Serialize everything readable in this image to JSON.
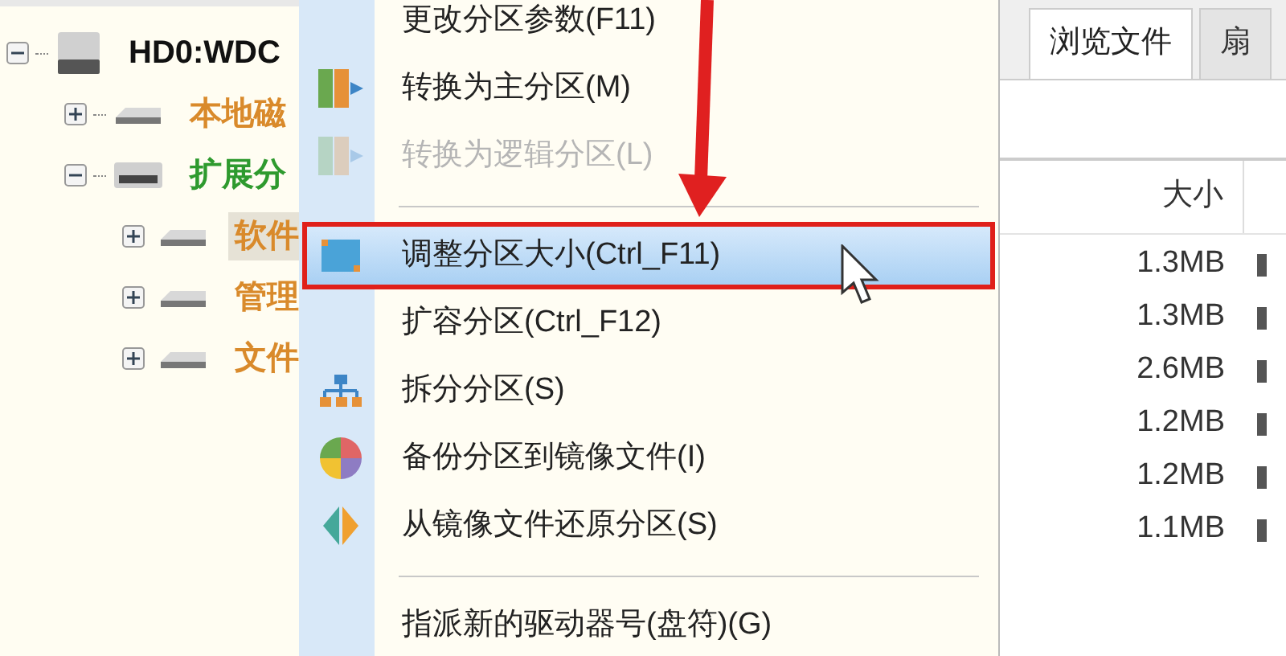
{
  "tree": {
    "label": "HD0:WDC",
    "expanded": true,
    "children": [
      {
        "label": "本地磁",
        "expanded": false,
        "kind": "primary"
      },
      {
        "label": "扩展分",
        "expanded": true,
        "kind": "extended",
        "children": [
          {
            "label": "软件",
            "expanded": false,
            "kind": "logical",
            "selected": true
          },
          {
            "label": "管理",
            "expanded": false,
            "kind": "logical",
            "selected": false
          },
          {
            "label": "文件",
            "expanded": false,
            "kind": "logical",
            "selected": false
          }
        ]
      }
    ]
  },
  "context_menu": [
    {
      "kind": "item",
      "label": "更改分区参数(F11)",
      "disabled": false,
      "selected": false
    },
    {
      "kind": "item",
      "label": "转换为主分区(M)",
      "disabled": false,
      "selected": false
    },
    {
      "kind": "item",
      "label": "转换为逻辑分区(L)",
      "disabled": true,
      "selected": false
    },
    {
      "kind": "separator"
    },
    {
      "kind": "item",
      "label": "调整分区大小(Ctrl_F11)",
      "disabled": false,
      "selected": true
    },
    {
      "kind": "item",
      "label": "扩容分区(Ctrl_F12)",
      "disabled": false,
      "selected": false
    },
    {
      "kind": "item",
      "label": "拆分分区(S)",
      "disabled": false,
      "selected": false
    },
    {
      "kind": "item",
      "label": "备份分区到镜像文件(I)",
      "disabled": false,
      "selected": false
    },
    {
      "kind": "item",
      "label": "从镜像文件还原分区(S)",
      "disabled": false,
      "selected": false
    },
    {
      "kind": "separator"
    },
    {
      "kind": "item",
      "label": "指派新的驱动器号(盘符)(G)",
      "disabled": false,
      "selected": false
    }
  ],
  "tabs": [
    {
      "label": "浏览文件",
      "selected": true
    },
    {
      "label": "扇",
      "selected": false
    }
  ],
  "table": {
    "columns": [
      "大小"
    ],
    "rows": [
      [
        "1.3MB"
      ],
      [
        "1.3MB"
      ],
      [
        "2.6MB"
      ],
      [
        "1.2MB"
      ],
      [
        "1.2MB"
      ],
      [
        "1.1MB"
      ]
    ]
  }
}
